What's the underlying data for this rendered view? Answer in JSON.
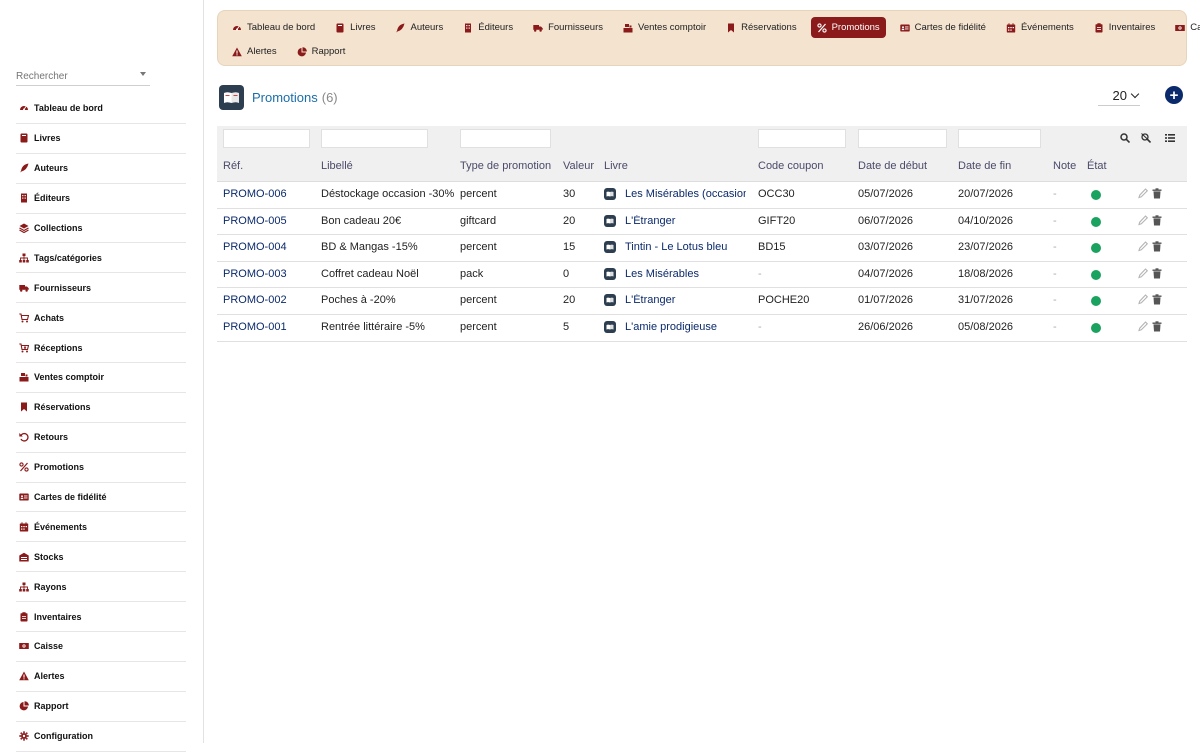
{
  "sidebar": {
    "search_placeholder": "Rechercher",
    "items": [
      {
        "label": "Tableau de bord",
        "icon": "gauge-icon"
      },
      {
        "label": "Livres",
        "icon": "book-icon"
      },
      {
        "label": "Auteurs",
        "icon": "feather-icon"
      },
      {
        "label": "Éditeurs",
        "icon": "building-icon"
      },
      {
        "label": "Collections",
        "icon": "layers-icon"
      },
      {
        "label": "Tags/catégories",
        "icon": "sitemap-icon"
      },
      {
        "label": "Fournisseurs",
        "icon": "truck-icon"
      },
      {
        "label": "Achats",
        "icon": "cart-icon"
      },
      {
        "label": "Réceptions",
        "icon": "cart-arrow-icon"
      },
      {
        "label": "Ventes comptoir",
        "icon": "cash-register-icon"
      },
      {
        "label": "Réservations",
        "icon": "bookmark-icon"
      },
      {
        "label": "Retours",
        "icon": "undo-icon"
      },
      {
        "label": "Promotions",
        "icon": "percent-icon"
      },
      {
        "label": "Cartes de fidélité",
        "icon": "id-card-icon"
      },
      {
        "label": "Événements",
        "icon": "calendar-icon"
      },
      {
        "label": "Stocks",
        "icon": "warehouse-icon"
      },
      {
        "label": "Rayons",
        "icon": "sitemap-icon"
      },
      {
        "label": "Inventaires",
        "icon": "clipboard-icon"
      },
      {
        "label": "Caisse",
        "icon": "money-icon"
      },
      {
        "label": "Alertes",
        "icon": "warning-icon"
      },
      {
        "label": "Rapport",
        "icon": "pie-chart-icon"
      },
      {
        "label": "Configuration",
        "icon": "gear-icon"
      }
    ]
  },
  "topnav": {
    "row1": [
      {
        "label": "Tableau de bord",
        "icon": "gauge-icon",
        "active": false
      },
      {
        "label": "Livres",
        "icon": "book-icon",
        "active": false
      },
      {
        "label": "Auteurs",
        "icon": "feather-icon",
        "active": false
      },
      {
        "label": "Éditeurs",
        "icon": "building-icon",
        "active": false
      },
      {
        "label": "Fournisseurs",
        "icon": "truck-icon",
        "active": false
      },
      {
        "label": "Ventes comptoir",
        "icon": "cash-register-icon",
        "active": false
      },
      {
        "label": "Réservations",
        "icon": "bookmark-icon",
        "active": false
      },
      {
        "label": "Promotions",
        "icon": "percent-icon",
        "active": true
      },
      {
        "label": "Cartes de fidélité",
        "icon": "id-card-icon",
        "active": false
      },
      {
        "label": "Événements",
        "icon": "calendar-icon",
        "active": false
      },
      {
        "label": "Inventaires",
        "icon": "clipboard-icon",
        "active": false
      },
      {
        "label": "Caisse",
        "icon": "money-icon",
        "active": false
      }
    ],
    "row2": [
      {
        "label": "Alertes",
        "icon": "warning-icon",
        "active": false
      },
      {
        "label": "Rapport",
        "icon": "pie-chart-icon",
        "active": false
      }
    ]
  },
  "page": {
    "title": "Promotions",
    "count": "(6)",
    "per_page": "20",
    "add_label": "+"
  },
  "table": {
    "headers": [
      "Réf.",
      "Libellé",
      "Type de promotion",
      "Valeur",
      "Livre",
      "Code coupon",
      "Date de début",
      "Date de fin",
      "Note",
      "État"
    ],
    "rows": [
      {
        "ref": "PROMO-006",
        "label": "Déstockage occasion -30%",
        "type": "percent",
        "value": "30",
        "book": "Les Misérables (occasion)",
        "coupon": "OCC30",
        "start": "05/07/2026",
        "end": "20/07/2026",
        "note": "-"
      },
      {
        "ref": "PROMO-005",
        "label": "Bon cadeau 20€",
        "type": "giftcard",
        "value": "20",
        "book": "L'Étranger",
        "coupon": "GIFT20",
        "start": "06/07/2026",
        "end": "04/10/2026",
        "note": "-"
      },
      {
        "ref": "PROMO-004",
        "label": "BD & Mangas -15%",
        "type": "percent",
        "value": "15",
        "book": "Tintin - Le Lotus bleu",
        "coupon": "BD15",
        "start": "03/07/2026",
        "end": "23/07/2026",
        "note": "-"
      },
      {
        "ref": "PROMO-003",
        "label": "Coffret cadeau Noël",
        "type": "pack",
        "value": "0",
        "book": "Les Misérables",
        "coupon": "-",
        "start": "04/07/2026",
        "end": "18/08/2026",
        "note": "-"
      },
      {
        "ref": "PROMO-002",
        "label": "Poches à -20%",
        "type": "percent",
        "value": "20",
        "book": "L'Étranger",
        "coupon": "POCHE20",
        "start": "01/07/2026",
        "end": "31/07/2026",
        "note": "-"
      },
      {
        "ref": "PROMO-001",
        "label": "Rentrée littéraire -5%",
        "type": "percent",
        "value": "5",
        "book": "L'amie prodigieuse",
        "coupon": "-",
        "start": "26/06/2026",
        "end": "05/08/2026",
        "note": "-"
      }
    ]
  },
  "colors": {
    "accent": "#8b1a1a",
    "link": "#0b2a6b",
    "status_active": "#1aa260",
    "nav_bg": "#f3e3cf"
  }
}
